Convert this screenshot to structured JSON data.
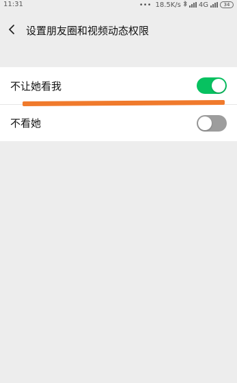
{
  "status_bar": {
    "time": "11:31",
    "dots": "•••",
    "net_speed": "18.5K/s",
    "bluetooth_icon": "bluetooth-icon",
    "network_type": "4G",
    "battery_level": "34"
  },
  "navbar": {
    "back_icon": "chevron-left-icon",
    "title": "设置朋友圈和视频动态权限"
  },
  "settings": [
    {
      "label": "不让她看我",
      "enabled": true
    },
    {
      "label": "不看她",
      "enabled": false
    }
  ],
  "colors": {
    "toggle_on": "#07c160",
    "toggle_off": "#9d9d9d",
    "annotation": "#f07a2c",
    "background": "#ededed"
  }
}
